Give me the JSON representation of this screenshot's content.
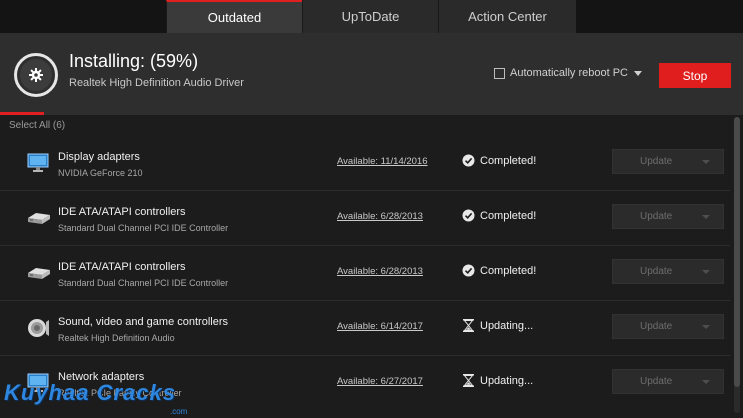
{
  "tabs": [
    {
      "label": "Outdated",
      "active": true
    },
    {
      "label": "UpToDate",
      "active": false
    },
    {
      "label": "Action Center",
      "active": false
    }
  ],
  "install": {
    "title": "Installing: (59%)",
    "subtitle": "Realtek High Definition Audio Driver",
    "progress_percent": 59,
    "reboot_label": "Automatically reboot PC",
    "reboot_checked": false,
    "stop_label": "Stop",
    "icon": "gear-icon"
  },
  "list": {
    "select_all_label": "Select All (6)",
    "update_label": "Update",
    "rows": [
      {
        "name": "Display adapters",
        "sub": "NVIDIA GeForce 210",
        "available": "Available: 11/14/2016",
        "status": "Completed!",
        "status_icon": "check-circle-icon",
        "device_icon": "monitor-icon"
      },
      {
        "name": "IDE ATA/ATAPI controllers",
        "sub": "Standard Dual Channel PCI IDE Controller",
        "available": "Available: 6/28/2013",
        "status": "Completed!",
        "status_icon": "check-circle-icon",
        "device_icon": "drive-icon"
      },
      {
        "name": "IDE ATA/ATAPI controllers",
        "sub": "Standard Dual Channel PCI IDE Controller",
        "available": "Available: 6/28/2013",
        "status": "Completed!",
        "status_icon": "check-circle-icon",
        "device_icon": "drive-icon"
      },
      {
        "name": "Sound, video and game controllers",
        "sub": "Realtek High Definition Audio",
        "available": "Available: 6/14/2017",
        "status": "Updating...",
        "status_icon": "hourglass-icon",
        "device_icon": "speaker-icon"
      },
      {
        "name": "Network adapters",
        "sub": "Realtek PCIe Family Controller",
        "available": "Available: 6/27/2017",
        "status": "Updating...",
        "status_icon": "hourglass-icon",
        "device_icon": "network-monitor-icon"
      }
    ]
  },
  "watermark": {
    "text": "Kuyhaa Cracks",
    "sub": ".com"
  },
  "colors": {
    "accent": "#e02020",
    "background": "#1e1e1e",
    "panel": "#2e2e2e",
    "watermark": "#2e86de"
  }
}
